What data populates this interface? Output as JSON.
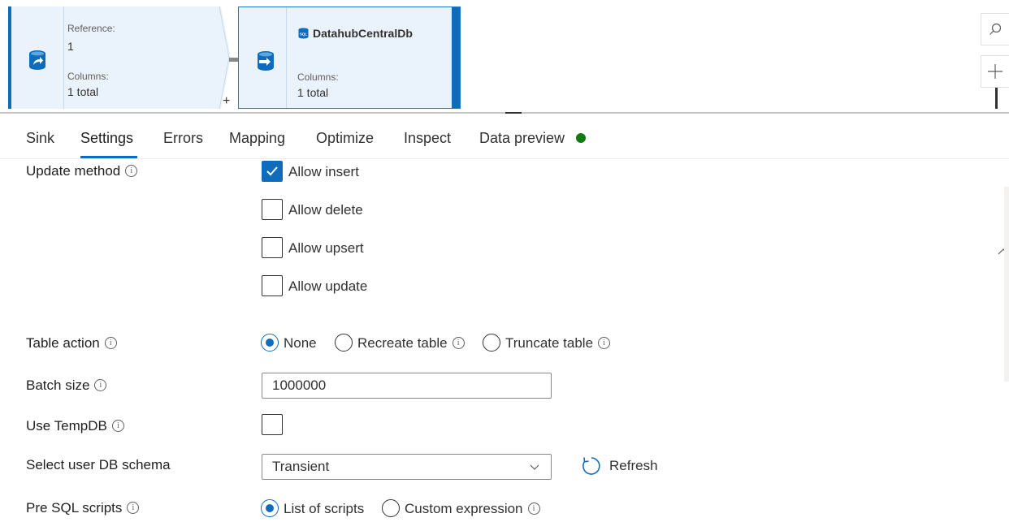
{
  "canvas": {
    "source_node": {
      "reference_label": "Reference:",
      "reference_value": "1",
      "columns_label": "Columns:",
      "columns_value": "1 total"
    },
    "sink_node": {
      "title": "DatahubCentralDb",
      "columns_label": "Columns:",
      "columns_value": "1 total"
    },
    "add_symbol": "+",
    "tools": {
      "search_icon": "search-icon",
      "zoom_in_icon": "plus-icon"
    }
  },
  "tabs": [
    {
      "label": "Sink"
    },
    {
      "label": "Settings"
    },
    {
      "label": "Errors"
    },
    {
      "label": "Mapping"
    },
    {
      "label": "Optimize"
    },
    {
      "label": "Inspect"
    },
    {
      "label": "Data preview"
    }
  ],
  "active_tab": "Settings",
  "data_preview_status_color": "#107c10",
  "form": {
    "update_method": {
      "label": "Update method",
      "options": [
        {
          "label": "Allow insert",
          "checked": true
        },
        {
          "label": "Allow delete",
          "checked": false
        },
        {
          "label": "Allow upsert",
          "checked": false
        },
        {
          "label": "Allow update",
          "checked": false
        }
      ]
    },
    "table_action": {
      "label": "Table action",
      "options": [
        {
          "label": "None",
          "selected": true
        },
        {
          "label": "Recreate table",
          "selected": false
        },
        {
          "label": "Truncate table",
          "selected": false
        }
      ]
    },
    "batch_size": {
      "label": "Batch size",
      "value": "1000000"
    },
    "use_tempdb": {
      "label": "Use TempDB",
      "checked": false
    },
    "user_db_schema": {
      "label": "Select user DB schema",
      "value": "Transient",
      "refresh_label": "Refresh"
    },
    "pre_sql_scripts": {
      "label": "Pre SQL scripts",
      "options": [
        {
          "label": "List of scripts",
          "selected": true
        },
        {
          "label": "Custom expression",
          "selected": false
        }
      ]
    }
  },
  "accent_color": "#0f6cbd"
}
